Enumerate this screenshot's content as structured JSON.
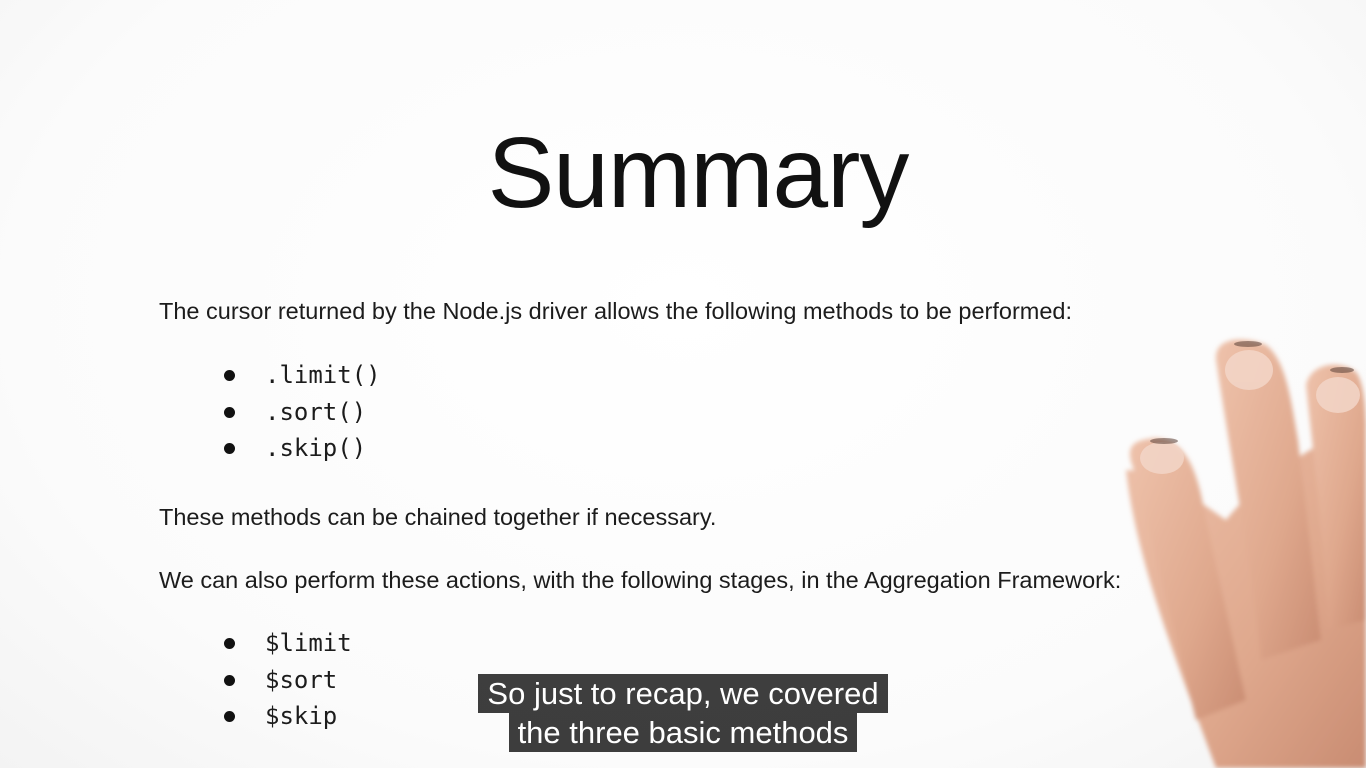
{
  "slide": {
    "title": "Summary",
    "intro": "The cursor returned by the Node.js driver allows the following methods to be performed:",
    "cursor_methods": [
      ".limit()",
      ".sort()",
      ".skip()"
    ],
    "chain_note": "These methods can be chained together if necessary.",
    "aggregation_intro": "We can also perform these actions, with the following stages, in the Aggregation Framework:",
    "aggregation_stages": [
      "$limit",
      "$sort",
      "$skip"
    ]
  },
  "captions": {
    "line1": "So just to recap, we covered",
    "line2": "the three basic methods"
  },
  "colors": {
    "background": "#ffffff",
    "text": "#1c1c1c",
    "caption_bg": "#080808",
    "caption_text": "#ffffff",
    "skin": "#e8b49a"
  }
}
